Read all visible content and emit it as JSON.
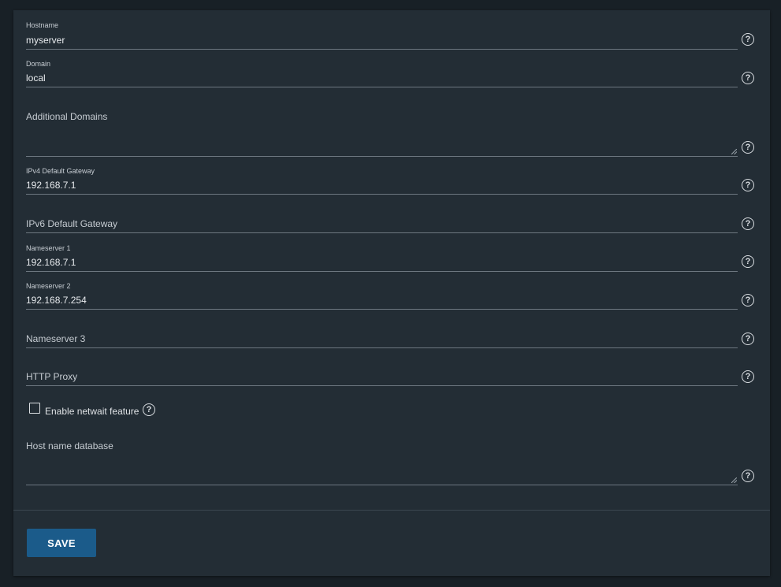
{
  "form": {
    "hostname": {
      "label": "Hostname",
      "value": "myserver"
    },
    "domain": {
      "label": "Domain",
      "value": "local"
    },
    "additional_domains": {
      "placeholder": "Additional Domains",
      "value": ""
    },
    "ipv4_gateway": {
      "label": "IPv4 Default Gateway",
      "value": "192.168.7.1"
    },
    "ipv6_gateway": {
      "placeholder": "IPv6 Default Gateway",
      "value": ""
    },
    "nameserver1": {
      "label": "Nameserver 1",
      "value": "192.168.7.1"
    },
    "nameserver2": {
      "label": "Nameserver 2",
      "value": "192.168.7.254"
    },
    "nameserver3": {
      "placeholder": "Nameserver 3",
      "value": ""
    },
    "http_proxy": {
      "placeholder": "HTTP Proxy",
      "value": ""
    },
    "netwait": {
      "label": "Enable netwait feature",
      "checked": false
    },
    "hostname_database": {
      "placeholder": "Host name database",
      "value": ""
    }
  },
  "help_glyph": "?",
  "icons": {
    "help": "help-circle-icon",
    "resize": "resize-handle-icon"
  },
  "actions": {
    "save_label": "SAVE"
  },
  "colors": {
    "background": "#182026",
    "card": "#232d35",
    "primary_button": "#1b5b8a",
    "underline": "#6d7780"
  }
}
